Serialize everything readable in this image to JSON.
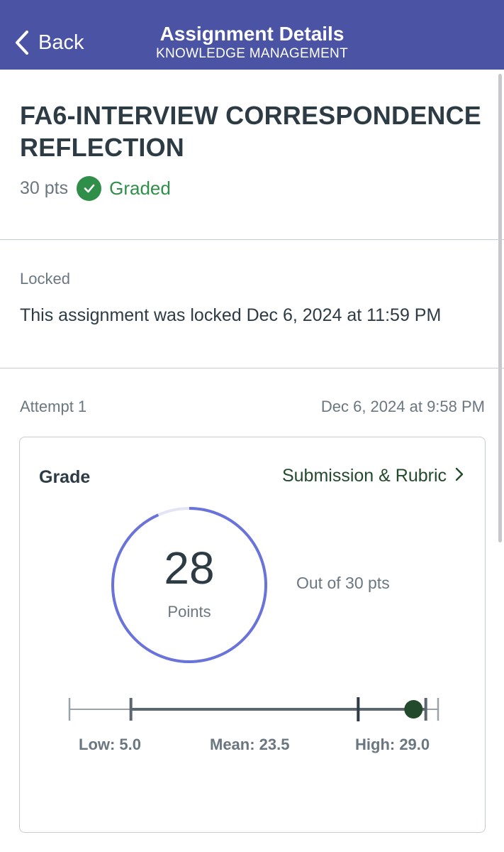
{
  "nav": {
    "back_label": "Back",
    "title": "Assignment Details",
    "subtitle": "KNOWLEDGE MANAGEMENT",
    "color": "#4a53a4"
  },
  "assignment": {
    "title": "FA6-INTERVIEW CORRESPONDENCE REFLECTION",
    "points": "30 pts",
    "status": "Graded",
    "status_icon": "check-circle-icon",
    "status_color": "#2f8f48"
  },
  "lock": {
    "label": "Locked",
    "message": "This assignment was locked Dec 6, 2024 at 11:59 PM"
  },
  "attempt": {
    "label": "Attempt 1",
    "submitted": "Dec 6, 2024 at 9:58 PM"
  },
  "grade": {
    "label": "Grade",
    "link_label": "Submission & Rubric",
    "score": "28",
    "score_unit": "Points",
    "out_of": "Out of 30 pts",
    "score_fraction": 0.9333,
    "gauge_color": "#6a73d9",
    "gauge_track_color": "#e3e5f7"
  },
  "distribution": {
    "min": 0,
    "max": 30,
    "low": 5.0,
    "mean": 23.5,
    "high": 29.0,
    "score": 28,
    "low_label": "Low: 5.0",
    "mean_label": "Mean: 23.5",
    "high_label": "High: 29.0",
    "score_color": "#234a2c"
  }
}
